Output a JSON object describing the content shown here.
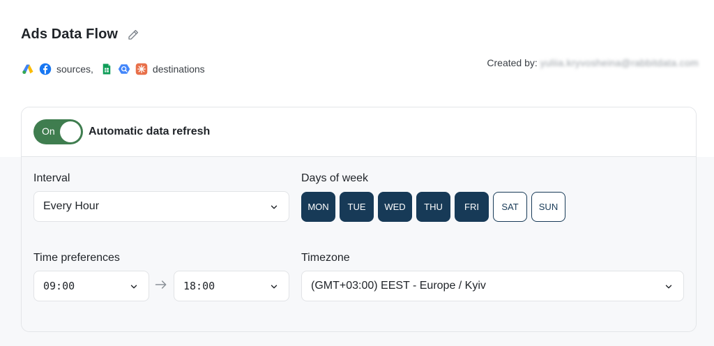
{
  "flow": {
    "title": "Ads Data Flow",
    "sources_label": "sources,",
    "destinations_label": "destinations",
    "source_icons": [
      "google-ads-icon",
      "facebook-icon"
    ],
    "destination_icons": [
      "google-sheets-icon",
      "bigquery-icon",
      "looker-studio-icon"
    ],
    "created_by_label": "Created by:",
    "created_by_value": "yuliia.kryvosheina@rabbitdata.com"
  },
  "refresh": {
    "toggle_label": "On",
    "toggle_state": "on",
    "title": "Automatic data refresh"
  },
  "interval": {
    "label": "Interval",
    "value": "Every Hour"
  },
  "days": {
    "label": "Days of week",
    "items": [
      {
        "label": "MON",
        "selected": true
      },
      {
        "label": "TUE",
        "selected": true
      },
      {
        "label": "WED",
        "selected": true
      },
      {
        "label": "THU",
        "selected": true
      },
      {
        "label": "FRI",
        "selected": true
      },
      {
        "label": "SAT",
        "selected": false
      },
      {
        "label": "SUN",
        "selected": false
      }
    ]
  },
  "time": {
    "label": "Time preferences",
    "from": "09:00",
    "to": "18:00"
  },
  "timezone": {
    "label": "Timezone",
    "value": "(GMT+03:00) EEST - Europe / Kyiv"
  },
  "colors": {
    "toggle_on": "#3f7d4f",
    "day_selected": "#173a57"
  }
}
